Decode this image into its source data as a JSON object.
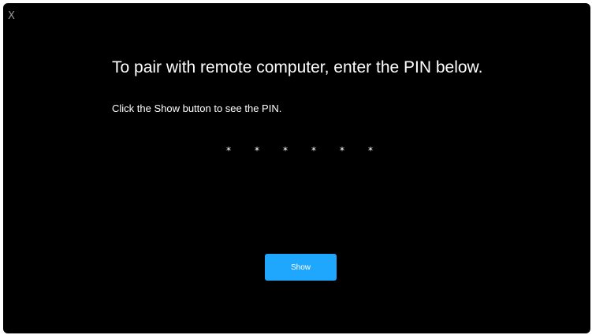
{
  "window": {
    "close_label": "X",
    "close_icon": "close-icon"
  },
  "dialog": {
    "title": "To pair with remote computer, enter the PIN below.",
    "subtitle": "Click the Show button to see the PIN.",
    "pin_masked": [
      "*",
      "*",
      "*",
      "*",
      "*",
      "*"
    ],
    "show_label": "Show"
  },
  "colors": {
    "background": "#000000",
    "text": "#ffffff",
    "accent": "#1ea7fd"
  }
}
